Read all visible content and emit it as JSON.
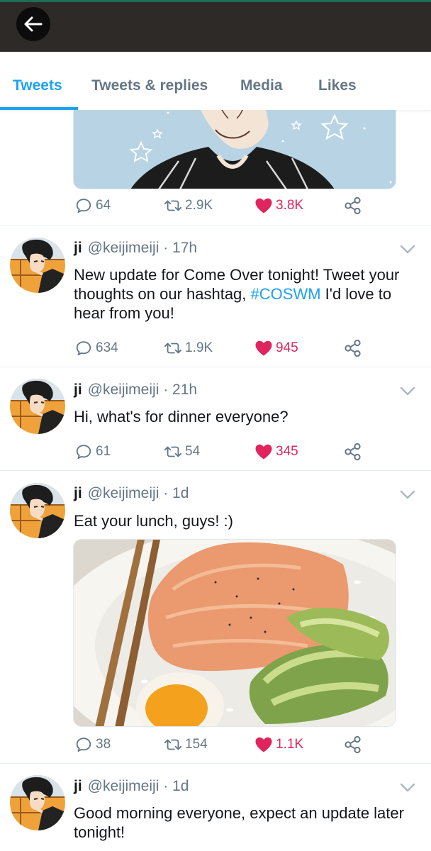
{
  "header": {
    "back_icon": "arrow-left-icon"
  },
  "tabs": [
    {
      "label": "Tweets",
      "active": true
    },
    {
      "label": "Tweets & replies",
      "active": false
    },
    {
      "label": "Media",
      "active": false
    },
    {
      "label": "Likes",
      "active": false
    }
  ],
  "colors": {
    "accent": "#1da1f2",
    "like": "#e0245e",
    "muted": "#657786",
    "topbar": "#2d2a27"
  },
  "tweet0": {
    "media_icon": "anime-character-image",
    "stats": {
      "replies": "64",
      "retweets": "2.9K",
      "likes": "3.8K"
    }
  },
  "tweet1": {
    "name": "ji",
    "handle": "@keijimeiji",
    "sep": "·",
    "time": "17h",
    "text_before": "New update for Come Over tonight! Tweet your thoughts on our hashtag, ",
    "hashtag": "#COSWM",
    "text_after": " I'd love to hear from you!",
    "stats": {
      "replies": "634",
      "retweets": "1.9K",
      "likes": "945"
    }
  },
  "tweet2": {
    "name": "ji",
    "handle": "@keijimeiji",
    "sep": "·",
    "time": "21h",
    "text": "Hi, what's for dinner everyone?",
    "stats": {
      "replies": "61",
      "retweets": "54",
      "likes": "345"
    }
  },
  "tweet3": {
    "name": "ji",
    "handle": "@keijimeiji",
    "sep": "·",
    "time": "1d",
    "text": "Eat your lunch, guys! :)",
    "media_icon": "salmon-rice-bowl-image",
    "stats": {
      "replies": "38",
      "retweets": "154",
      "likes": "1.1K"
    }
  },
  "tweet4": {
    "name": "ji",
    "handle": "@keijimeiji",
    "sep": "·",
    "time": "1d",
    "text": "Good morning everyone, expect an update later tonight!"
  }
}
